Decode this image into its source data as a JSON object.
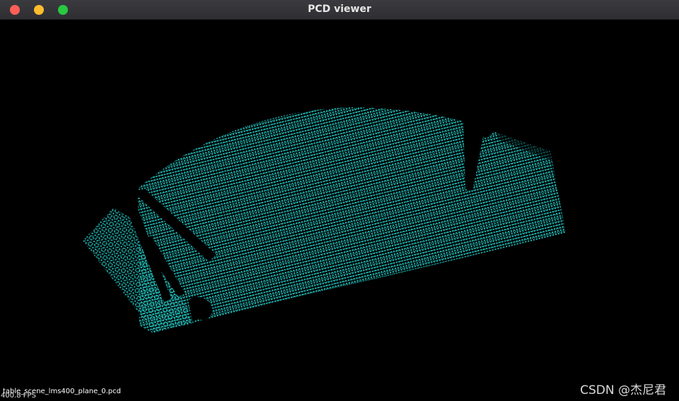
{
  "window": {
    "title": "PCD viewer",
    "controls": [
      "close-icon",
      "minimize-icon",
      "maximize-icon"
    ]
  },
  "viewer": {
    "background": "#000000",
    "point_color": "#1fb1ad"
  },
  "overlay": {
    "filename": "table_scene_lms400_plane_0.pcd",
    "fps": "400.8 FPS"
  },
  "watermark": "CSDN @杰尼君"
}
